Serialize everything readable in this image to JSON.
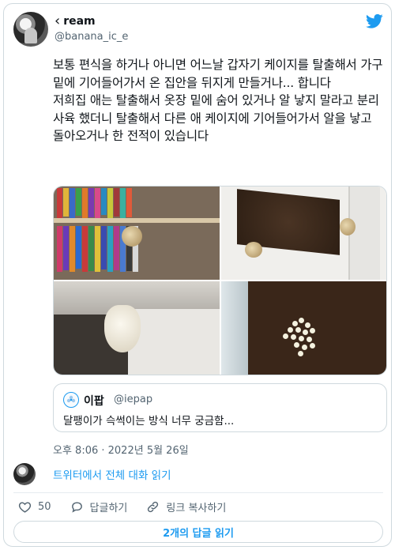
{
  "author": {
    "name": "ream",
    "handle": "@banana_ic_e"
  },
  "tweet": {
    "text": "보통 편식을 하거나 아니면 어느날 갑자기 케이지를 탈출해서 가구 밑에 기어들어가서 온 집안을 뒤지게 만들거나... 합니다\n저희집 애는 탈출해서 옷장 밑에 숨어 있거나 알 낳지 말라고 분리사육 했더니 탈출해서 다른 애 케이지에 기어들어가서 알을 낳고 돌아오거나 한 전적이 있습니다"
  },
  "quoted_tweet": {
    "name": "이팝",
    "handle": "@iepap",
    "text": "달팽이가 슥썩이는 방식 너무 궁금함..."
  },
  "timestamp": "오후 8:06 · 2022년 5월 26일",
  "thread_link": "트위터에서 전체 대화 읽기",
  "actions": {
    "likes": "50",
    "reply": "답글하기",
    "copy_link": "링크 복사하기"
  },
  "replies_button": "2개의 답글 읽기",
  "colors": {
    "accent": "#1d9bf0",
    "text": "#0f1419",
    "muted": "#536471",
    "border": "#cfd9de"
  },
  "icons": [
    "chevron-left-icon",
    "twitter-bird-icon",
    "heart-icon",
    "reply-bubble-icon",
    "link-icon"
  ]
}
